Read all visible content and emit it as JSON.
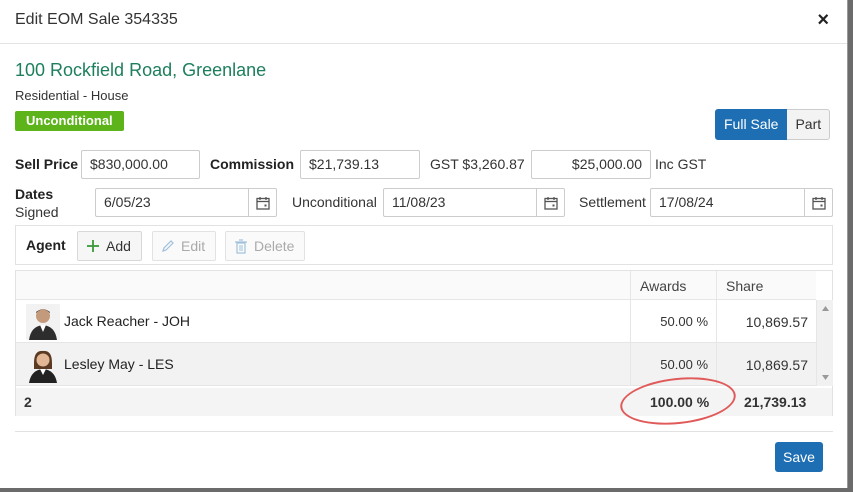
{
  "dialog": {
    "title": "Edit EOM Sale 354335",
    "close": "×"
  },
  "property": {
    "address": "100 Rockfield Road, Greenlane",
    "type": "Residential - House",
    "status": "Unconditional"
  },
  "sale_mode": {
    "full": "Full Sale",
    "part": "Part"
  },
  "price": {
    "sell_label": "Sell Price",
    "sell_value": "$830,000.00",
    "commission_label": "Commission",
    "commission_value": "$21,739.13",
    "gst_text": "GST $3,260.87",
    "other_value": "$25,000.00",
    "inc_gst": "Inc GST"
  },
  "dates": {
    "label_dates": "Dates",
    "label_signed": "Signed",
    "signed_value": "6/05/23",
    "unconditional_label": "Unconditional",
    "unconditional_value": "11/08/23",
    "settlement_label": "Settlement",
    "settlement_value": "17/08/24"
  },
  "toolbar": {
    "agent": "Agent",
    "add": "Add",
    "edit": "Edit",
    "delete": "Delete"
  },
  "grid": {
    "headers": {
      "awards": "Awards",
      "share": "Share"
    },
    "rows": [
      {
        "name": "Jack Reacher - JOH",
        "awards": "50.00 %",
        "share": "10,869.57"
      },
      {
        "name": "Lesley May - LES",
        "awards": "50.00 %",
        "share": "10,869.57"
      }
    ],
    "footer": {
      "count": "2",
      "awards": "100.00 %",
      "share": "21,739.13"
    }
  },
  "actions": {
    "save": "Save"
  },
  "colors": {
    "accent": "#1e6eb3",
    "address": "#1e7f5c",
    "badge": "#5cb31a",
    "annotation": "#e05a5a"
  }
}
